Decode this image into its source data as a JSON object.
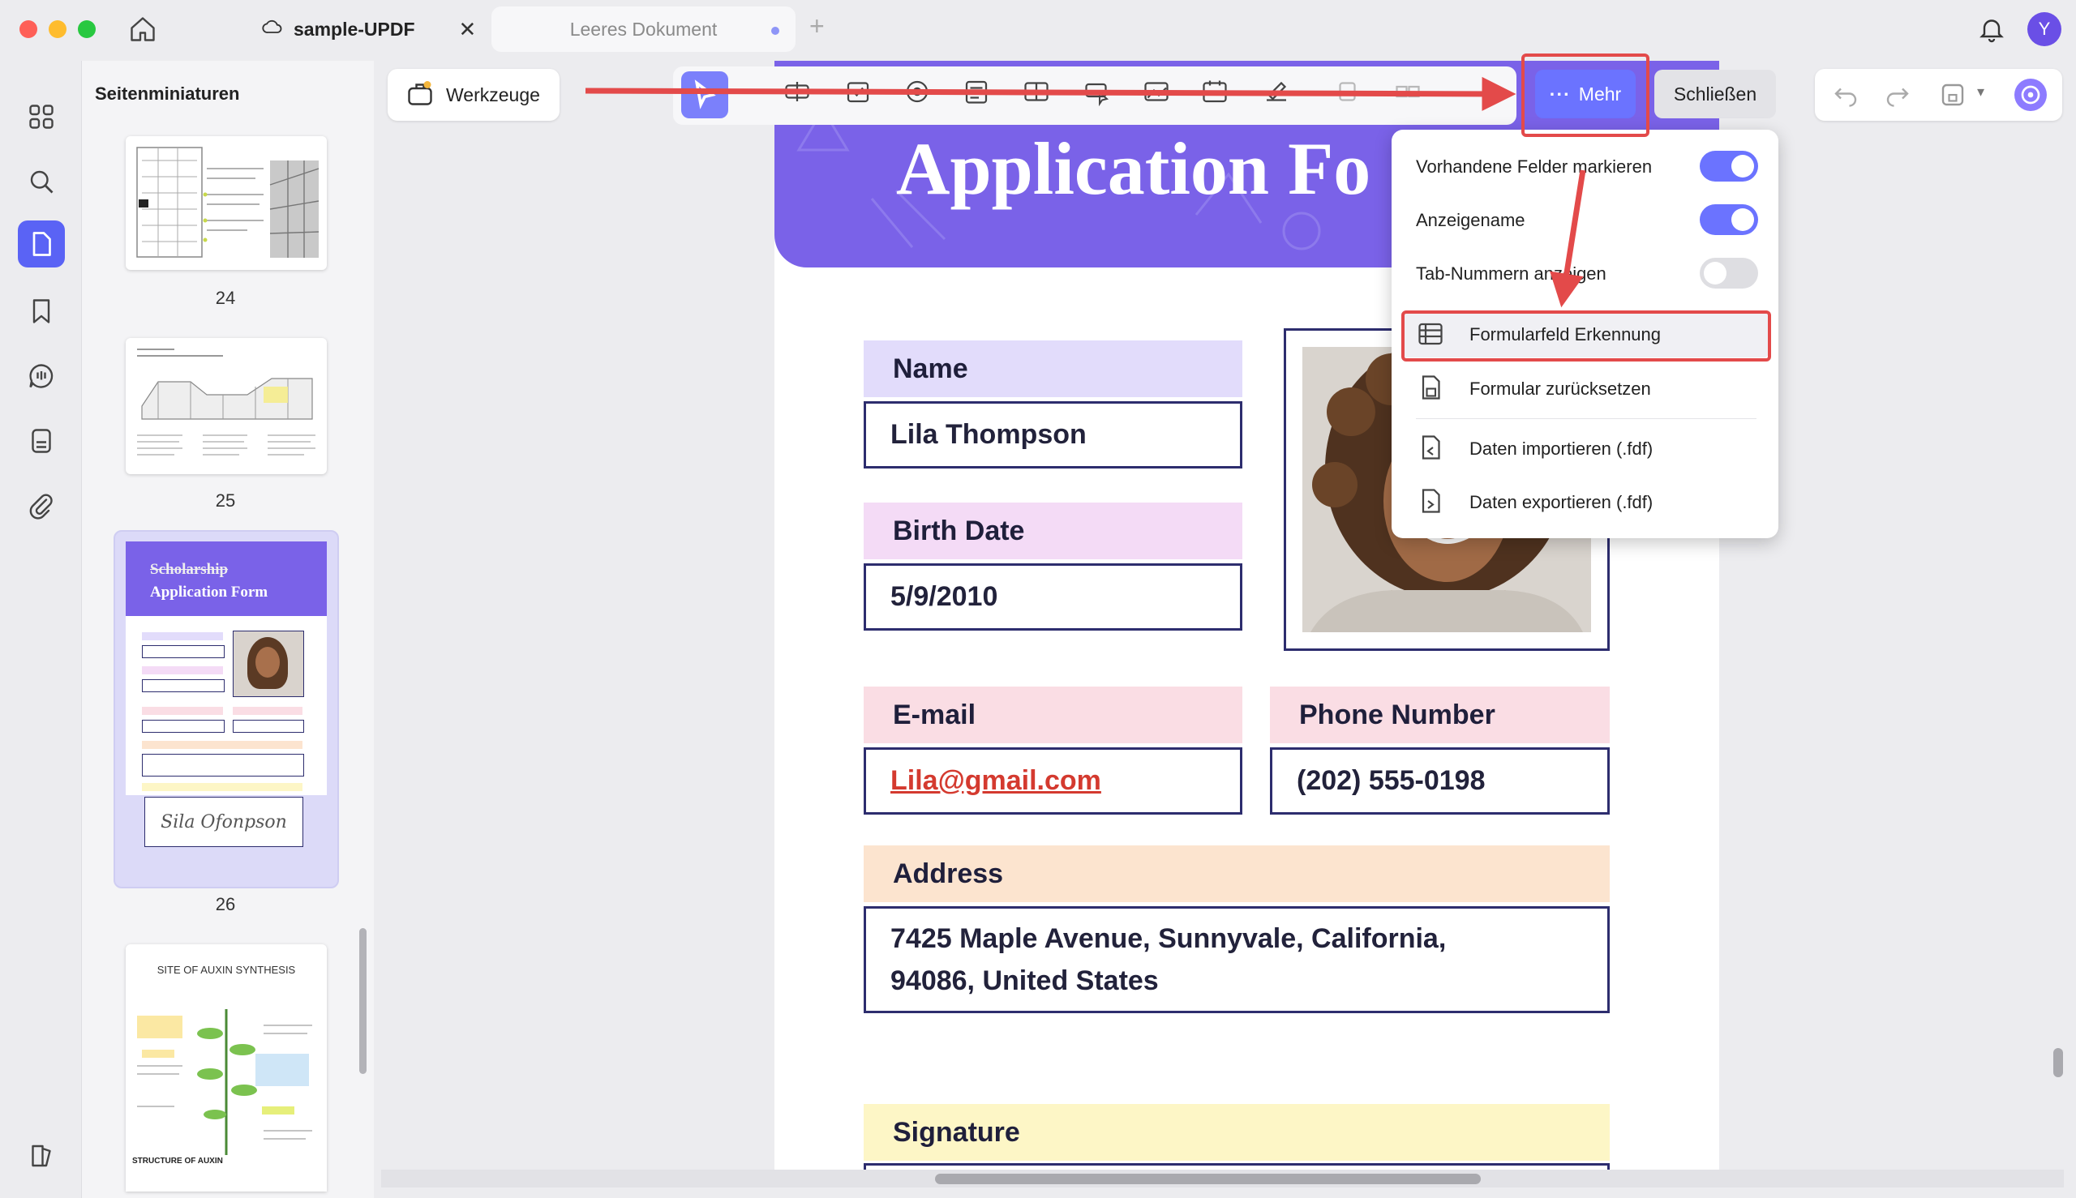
{
  "tabs": [
    {
      "label": "sample-UPDF"
    },
    {
      "label": "Leeres Dokument"
    }
  ],
  "user": {
    "initial": "Y"
  },
  "sidebar": {
    "title": "Seitenminiaturen",
    "pages": [
      "24",
      "25",
      "26"
    ],
    "thumb26": {
      "line1": "Scholarship",
      "line2": "Application Form",
      "signature": "Sila Ofonpson"
    },
    "thumb27": {
      "title": "SITE OF AUXIN SYNTHESIS",
      "bottom": "STRUCTURE OF AUXIN"
    }
  },
  "toolbar": {
    "tools_label": "Werkzeuge",
    "more_label": "Mehr",
    "close_label": "Schließen"
  },
  "form": {
    "header_title": "Application Fo",
    "name_label": "Name",
    "name_value": "Lila Thompson",
    "birth_label": "Birth Date",
    "birth_value": "5/9/2010",
    "email_label": "E-mail",
    "email_value": "Lila@gmail.com",
    "phone_label": "Phone Number",
    "phone_value": "(202) 555-0198",
    "address_label": "Address",
    "address_line1": "7425 Maple Avenue, Sunnyvale, California,",
    "address_line2": "94086, United States",
    "signature_label": "Signature"
  },
  "menu": {
    "highlight_fields": "Vorhandene Felder markieren",
    "display_name": "Anzeigename",
    "tab_numbers": "Tab-Nummern anzeigen",
    "field_recognition": "Formularfeld Erkennung",
    "reset_form": "Formular zurücksetzen",
    "import_data": "Daten importieren (.fdf)",
    "export_data": "Daten exportieren (.fdf)",
    "toggle_states": {
      "highlight_fields": true,
      "display_name": true,
      "tab_numbers": false
    }
  },
  "colors": {
    "accent": "#6b73ff",
    "header_purple": "#7a62e8",
    "annotation_red": "#e34a4a",
    "name_label_bg": "#e2dcfb",
    "birth_label_bg": "#f4dbf6",
    "email_label_bg": "#fadde4",
    "address_label_bg": "#fce4cf",
    "signature_label_bg": "#fdf6c6"
  }
}
